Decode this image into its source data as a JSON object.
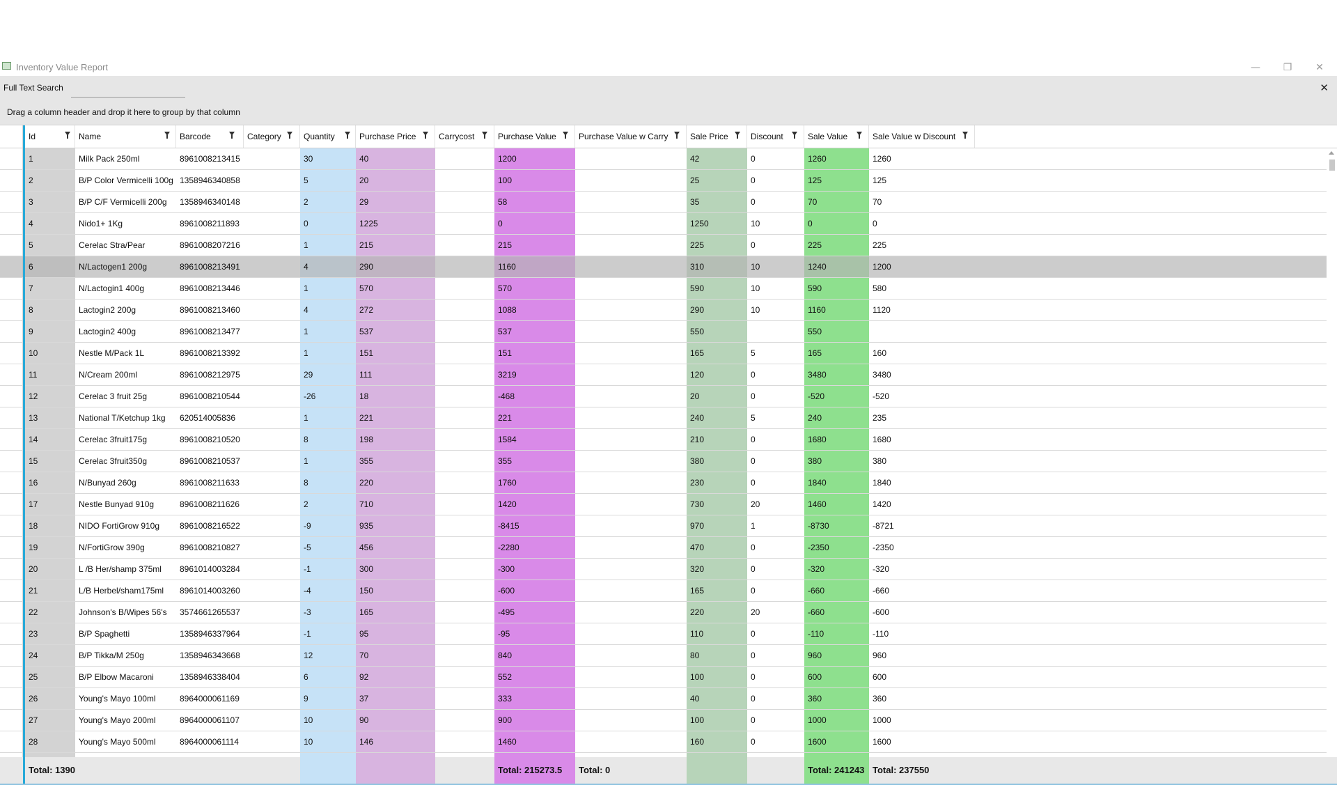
{
  "window": {
    "title": "Inventory Value Report",
    "controls": {
      "minimize": "—",
      "restore": "❐",
      "close": "✕"
    }
  },
  "search": {
    "label": "Full Text Search",
    "value": "",
    "close": "✕"
  },
  "group_panel": {
    "text": "Drag a column header and drop it here to group by that column"
  },
  "columns": [
    {
      "key": "id",
      "label": "Id"
    },
    {
      "key": "name",
      "label": "Name"
    },
    {
      "key": "barcode",
      "label": "Barcode"
    },
    {
      "key": "category",
      "label": "Category"
    },
    {
      "key": "quantity",
      "label": "Quantity"
    },
    {
      "key": "purchase_price",
      "label": "Purchase Price"
    },
    {
      "key": "carrycost",
      "label": "Carrycost"
    },
    {
      "key": "purchase_value",
      "label": "Purchase Value"
    },
    {
      "key": "purchase_value_w_carry",
      "label": "Purchase Value w Carry"
    },
    {
      "key": "sale_price",
      "label": "Sale Price"
    },
    {
      "key": "discount",
      "label": "Discount"
    },
    {
      "key": "sale_value",
      "label": "Sale Value"
    },
    {
      "key": "sale_value_w_discount",
      "label": "Sale Value w Discount"
    }
  ],
  "column_colors": {
    "id": "#d3d3d3",
    "quantity": "#c6e2f7",
    "purchase_price": "#d8b4e0",
    "purchase_value": "#d98ae8",
    "sale_price": "#b7d4b9",
    "sale_value": "#8ee08e"
  },
  "selected_row_index": 5,
  "rows": [
    [
      "1",
      "Milk Pack 250ml",
      "8961008213415",
      "",
      "30",
      "40",
      "",
      "1200",
      "",
      "42",
      "0",
      "1260",
      "1260"
    ],
    [
      "2",
      "B/P Color Vermicelli 100g",
      "1358946340858",
      "",
      "5",
      "20",
      "",
      "100",
      "",
      "25",
      "0",
      "125",
      "125"
    ],
    [
      "3",
      "B/P C/F Vermicelli 200g",
      "1358946340148",
      "",
      "2",
      "29",
      "",
      "58",
      "",
      "35",
      "0",
      "70",
      "70"
    ],
    [
      "4",
      "Nido1+ 1Kg",
      "8961008211893",
      "",
      "0",
      "1225",
      "",
      "0",
      "",
      "1250",
      "10",
      "0",
      "0"
    ],
    [
      "5",
      "Cerelac Stra/Pear",
      "8961008207216",
      "",
      "1",
      "215",
      "",
      "215",
      "",
      "225",
      "0",
      "225",
      "225"
    ],
    [
      "6",
      "N/Lactogen1 200g",
      "8961008213491",
      "",
      "4",
      "290",
      "",
      "1160",
      "",
      "310",
      "10",
      "1240",
      "1200"
    ],
    [
      "7",
      "N/Lactogin1 400g",
      "8961008213446",
      "",
      "1",
      "570",
      "",
      "570",
      "",
      "590",
      "10",
      "590",
      "580"
    ],
    [
      "8",
      "Lactogin2 200g",
      "8961008213460",
      "",
      "4",
      "272",
      "",
      "1088",
      "",
      "290",
      "10",
      "1160",
      "1120"
    ],
    [
      "9",
      "Lactogin2 400g",
      "8961008213477",
      "",
      "1",
      "537",
      "",
      "537",
      "",
      "550",
      "",
      "550",
      ""
    ],
    [
      "10",
      "Nestle M/Pack 1L",
      "8961008213392",
      "",
      "1",
      "151",
      "",
      "151",
      "",
      "165",
      "5",
      "165",
      "160"
    ],
    [
      "11",
      "N/Cream 200ml",
      "8961008212975",
      "",
      "29",
      "111",
      "",
      "3219",
      "",
      "120",
      "0",
      "3480",
      "3480"
    ],
    [
      "12",
      "Cerelac 3 fruit 25g",
      "8961008210544",
      "",
      "-26",
      "18",
      "",
      "-468",
      "",
      "20",
      "0",
      "-520",
      "-520"
    ],
    [
      "13",
      "National T/Ketchup 1kg",
      "620514005836",
      "",
      "1",
      "221",
      "",
      "221",
      "",
      "240",
      "5",
      "240",
      "235"
    ],
    [
      "14",
      "Cerelac 3fruit175g",
      "8961008210520",
      "",
      "8",
      "198",
      "",
      "1584",
      "",
      "210",
      "0",
      "1680",
      "1680"
    ],
    [
      "15",
      "Cerelac 3fruit350g",
      "8961008210537",
      "",
      "1",
      "355",
      "",
      "355",
      "",
      "380",
      "0",
      "380",
      "380"
    ],
    [
      "16",
      "N/Bunyad 260g",
      "8961008211633",
      "",
      "8",
      "220",
      "",
      "1760",
      "",
      "230",
      "0",
      "1840",
      "1840"
    ],
    [
      "17",
      "Nestle Bunyad 910g",
      "8961008211626",
      "",
      "2",
      "710",
      "",
      "1420",
      "",
      "730",
      "20",
      "1460",
      "1420"
    ],
    [
      "18",
      "NIDO FortiGrow 910g",
      "8961008216522",
      "",
      "-9",
      "935",
      "",
      "-8415",
      "",
      "970",
      "1",
      "-8730",
      "-8721"
    ],
    [
      "19",
      "N/FortiGrow 390g",
      "8961008210827",
      "",
      "-5",
      "456",
      "",
      "-2280",
      "",
      "470",
      "0",
      "-2350",
      "-2350"
    ],
    [
      "20",
      "L /B Her/shamp 375ml",
      "8961014003284",
      "",
      "-1",
      "300",
      "",
      "-300",
      "",
      "320",
      "0",
      "-320",
      "-320"
    ],
    [
      "21",
      "L/B Herbel/sham175ml",
      "8961014003260",
      "",
      "-4",
      "150",
      "",
      "-600",
      "",
      "165",
      "0",
      "-660",
      "-660"
    ],
    [
      "22",
      "Johnson's B/Wipes 56's",
      "3574661265537",
      "",
      "-3",
      "165",
      "",
      "-495",
      "",
      "220",
      "20",
      "-660",
      "-600"
    ],
    [
      "23",
      "B/P Spaghetti",
      "1358946337964",
      "",
      "-1",
      "95",
      "",
      "-95",
      "",
      "110",
      "0",
      "-110",
      "-110"
    ],
    [
      "24",
      "B/P Tikka/M 250g",
      "1358946343668",
      "",
      "12",
      "70",
      "",
      "840",
      "",
      "80",
      "0",
      "960",
      "960"
    ],
    [
      "25",
      "B/P Elbow Macaroni",
      "1358946338404",
      "",
      "6",
      "92",
      "",
      "552",
      "",
      "100",
      "0",
      "600",
      "600"
    ],
    [
      "26",
      "Young's Mayo 100ml",
      "8964000061169",
      "",
      "9",
      "37",
      "",
      "333",
      "",
      "40",
      "0",
      "360",
      "360"
    ],
    [
      "27",
      "Young's Mayo 200ml",
      "8964000061107",
      "",
      "10",
      "90",
      "",
      "900",
      "",
      "100",
      "0",
      "1000",
      "1000"
    ],
    [
      "28",
      "Young's Mayo 500ml",
      "8964000061114",
      "",
      "10",
      "146",
      "",
      "1460",
      "",
      "160",
      "0",
      "1600",
      "1600"
    ]
  ],
  "totals": {
    "id": "Total: 1390",
    "purchase_value": "Total: 215273.5",
    "purchase_value_w_carry": "Total: 0",
    "sale_value": "Total: 241243",
    "sale_value_w_discount": "Total: 237550"
  }
}
